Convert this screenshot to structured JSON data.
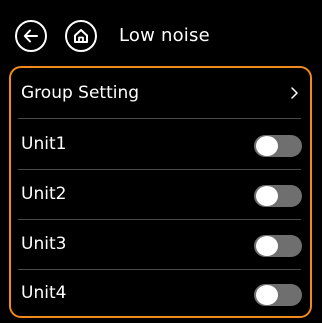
{
  "header": {
    "back_icon": "arrow-left-icon",
    "home_icon": "home-icon",
    "title": "Low noise"
  },
  "panel": {
    "border_color": "#f08a1c",
    "group_setting": {
      "label": "Group Setting",
      "chevron": "›"
    },
    "units": [
      {
        "label": "Unit1",
        "state": "off"
      },
      {
        "label": "Unit2",
        "state": "off"
      },
      {
        "label": "Unit3",
        "state": "off"
      },
      {
        "label": "Unit4",
        "state": "off"
      }
    ]
  },
  "colors": {
    "background": "#000000",
    "text": "#ffffff",
    "accent": "#f08a1c",
    "toggle_off": "#6f6f6f",
    "divider": "#4a4a4a"
  }
}
